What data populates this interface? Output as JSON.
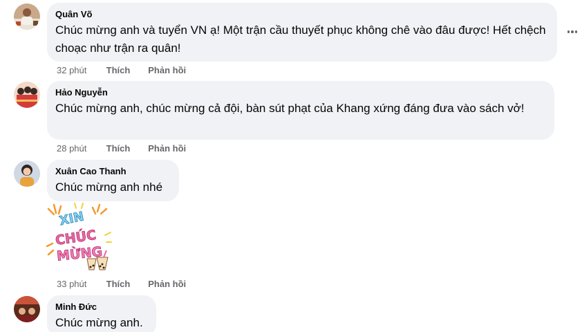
{
  "comments": [
    {
      "author": "Quân Võ",
      "text": "Chúc mừng anh và tuyển VN ạ! Một trận cầu thuyết phục không chê vào đâu được! Hết chệch choạc như trận ra quân!",
      "time": "32 phút",
      "like": "Thích",
      "reply": "Phản hồi"
    },
    {
      "author": "Hảo Nguyễn",
      "text": "Chúc mừng anh, chúc mừng cả đội, bàn sút phạt của Khang xứng đáng đưa vào sách vở!",
      "time": "28 phút",
      "like": "Thích",
      "reply": "Phản hồi"
    },
    {
      "author": "Xuân Cao Thanh",
      "text": "Chúc mừng anh nhé",
      "time": "33 phút",
      "like": "Thích",
      "reply": "Phản hồi",
      "sticker": {
        "line1": "XIN",
        "line2": "CHÚC",
        "line3": "MỪNG"
      }
    },
    {
      "author": "Minh Đức",
      "text": "Chúc mừng anh."
    }
  ],
  "icons": {
    "more": "more-horizontal-icon"
  },
  "colors": {
    "bubble": "#f0f2f5",
    "meta": "#65676b",
    "text": "#050505"
  }
}
